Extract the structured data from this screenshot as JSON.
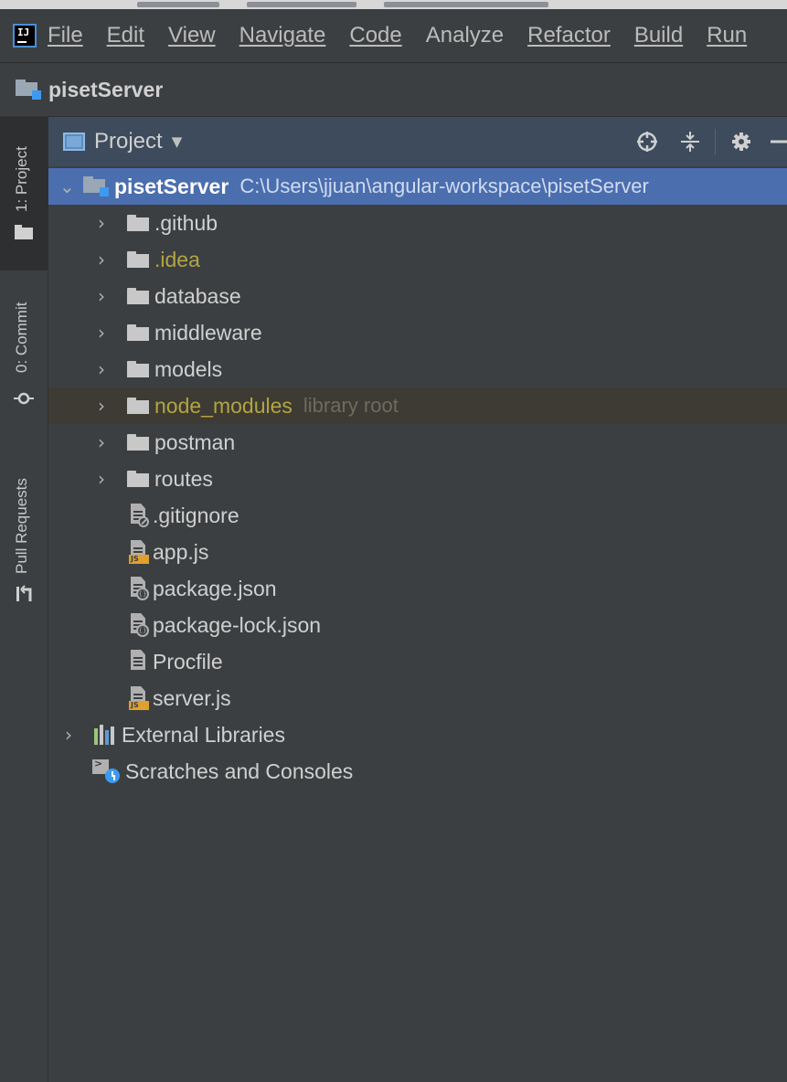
{
  "menu": {
    "logo_text": "IJ",
    "items": [
      "File",
      "Edit",
      "View",
      "Navigate",
      "Code",
      "Analyze",
      "Refactor",
      "Build",
      "Run"
    ]
  },
  "navbar": {
    "title": "pisetServer"
  },
  "stripe": {
    "project": "1: Project",
    "commit": "0: Commit",
    "pull_requests": "Pull Requests"
  },
  "panel": {
    "view_label": "Project",
    "icons": [
      "locate-icon",
      "collapse-all-icon",
      "gear-icon",
      "minimize-icon"
    ]
  },
  "tree": {
    "root": {
      "name": "pisetServer",
      "path": "C:\\Users\\jjuan\\angular-workspace\\pisetServer"
    },
    "folders": [
      {
        "name": ".github"
      },
      {
        "name": ".idea"
      },
      {
        "name": "database"
      },
      {
        "name": "middleware"
      },
      {
        "name": "models"
      },
      {
        "name": "node_modules",
        "hint": "library root"
      },
      {
        "name": "postman"
      },
      {
        "name": "routes"
      }
    ],
    "files": [
      {
        "name": ".gitignore",
        "kind": "ignore"
      },
      {
        "name": "app.js",
        "kind": "js"
      },
      {
        "name": "package.json",
        "kind": "json"
      },
      {
        "name": "package-lock.json",
        "kind": "json"
      },
      {
        "name": "Procfile",
        "kind": "text"
      },
      {
        "name": "server.js",
        "kind": "js"
      }
    ],
    "external_libraries": "External Libraries",
    "scratches": "Scratches and Consoles"
  },
  "colors": {
    "selection": "#4b6eaf",
    "excluded_folder_text": "#b4a542",
    "library_row": "#3d3b33"
  }
}
